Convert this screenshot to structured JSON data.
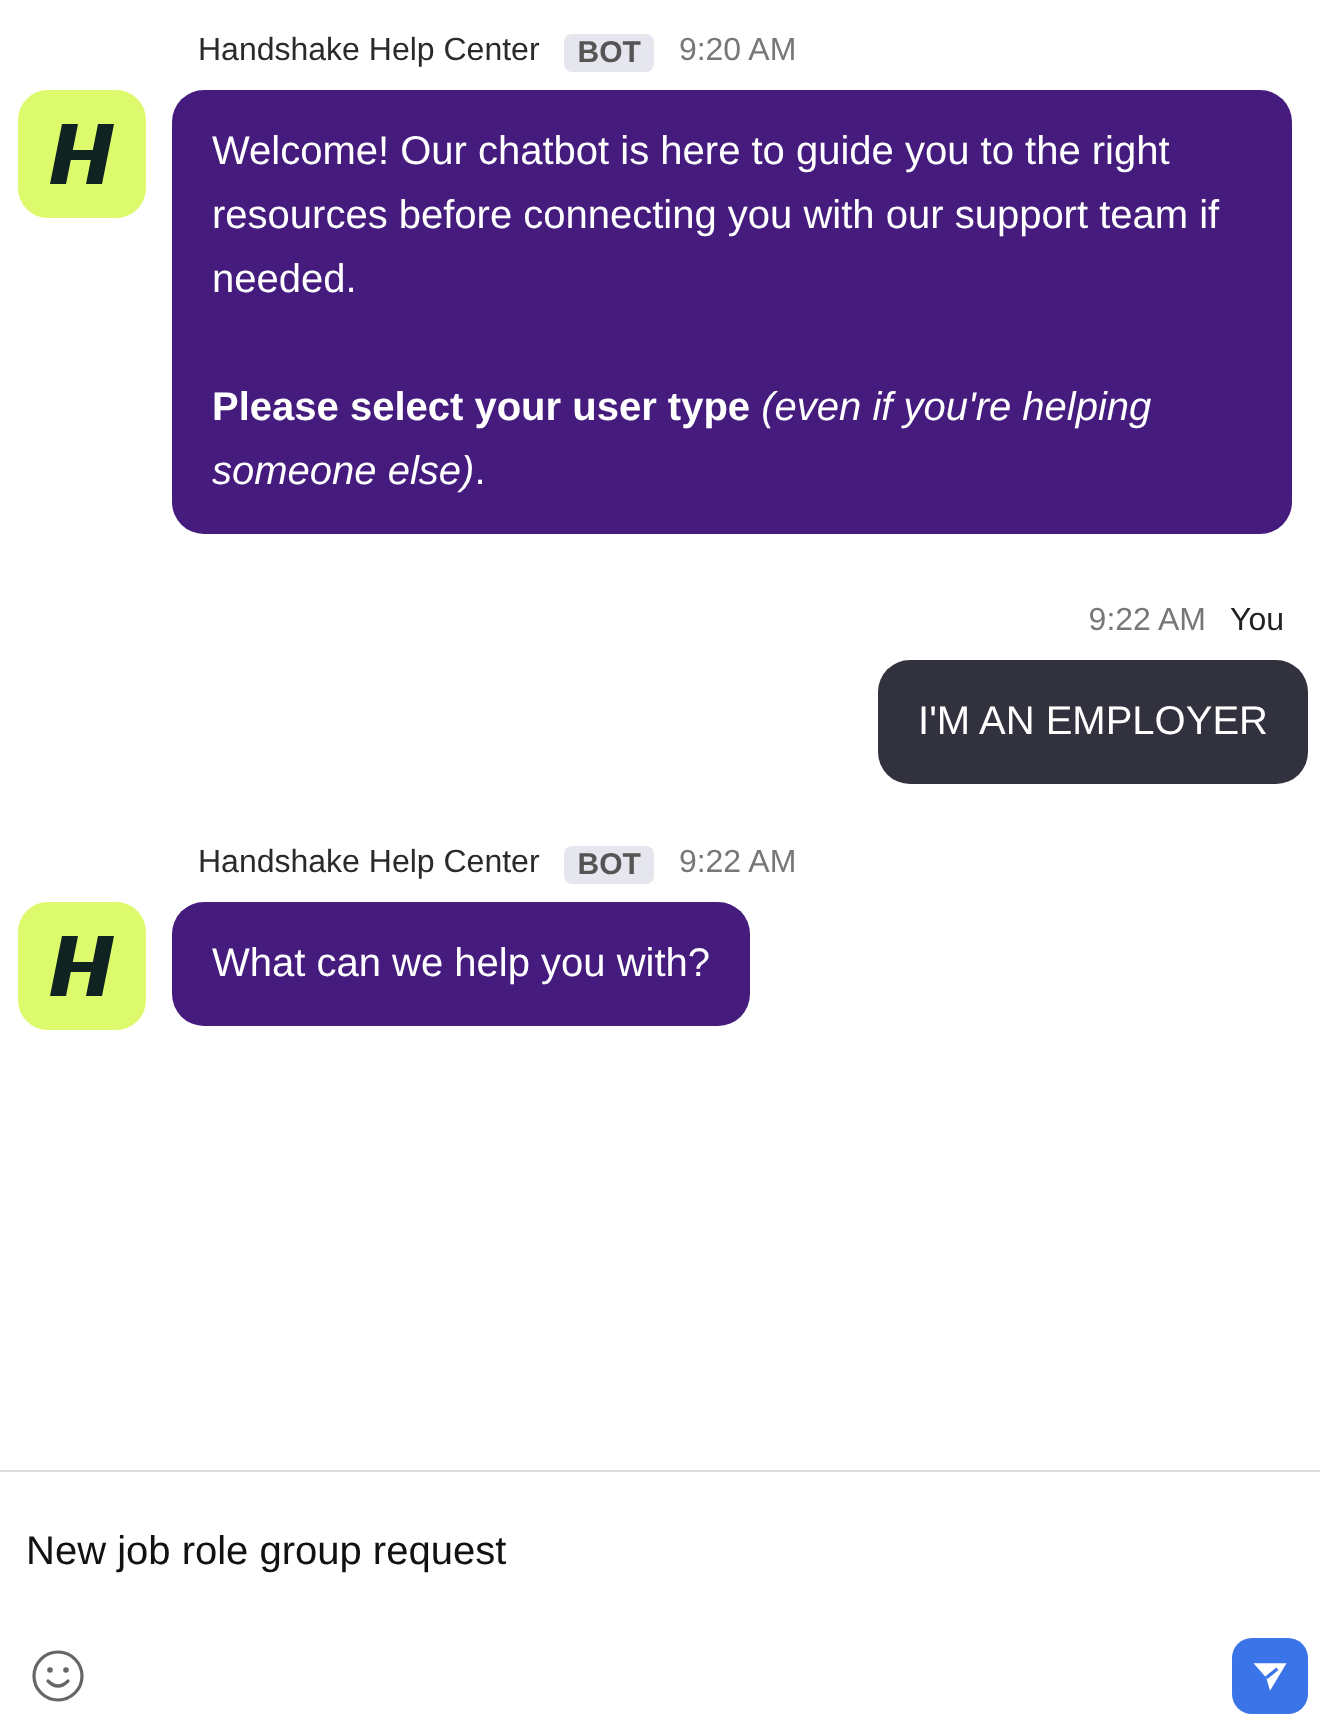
{
  "messages": [
    {
      "kind": "bot",
      "sender": "Handshake Help Center",
      "badge": "BOT",
      "time": "9:20 AM",
      "paragraphs": [
        "Welcome! Our chatbot is here to guide you to the right resources before connecting you with our support team if needed.",
        "**Please select your user type** *(even if you're helping someone else)*."
      ]
    },
    {
      "kind": "user",
      "sender": "You",
      "time": "9:22 AM",
      "paragraphs": [
        "I'M AN EMPLOYER"
      ]
    },
    {
      "kind": "bot",
      "sender": "Handshake Help Center",
      "badge": "BOT",
      "time": "9:22 AM",
      "paragraphs": [
        "What can we help you with?"
      ]
    }
  ],
  "composer": {
    "value": "New job role group request"
  }
}
